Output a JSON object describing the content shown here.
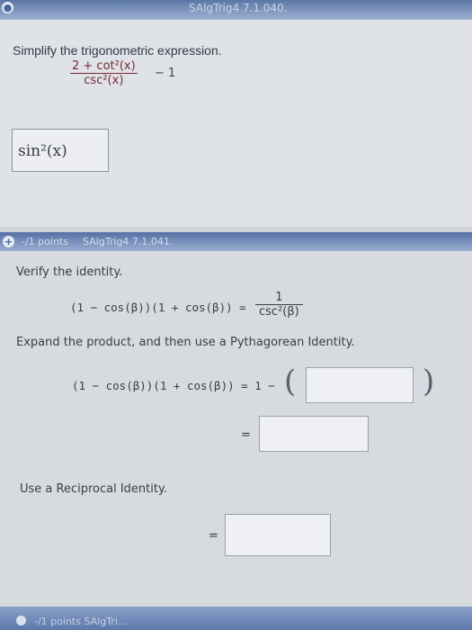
{
  "top_strip": {
    "faint_text": "SAlgTrig4 7.1.040."
  },
  "question1": {
    "prompt": "Simplify the trigonometric expression.",
    "numerator": "2 + cot²(x)",
    "denominator": "csc²(x)",
    "minus_term": "− 1",
    "answer": "sin²(x)"
  },
  "question2": {
    "points": "-/1 points",
    "code": "SAlgTrig4 7.1.041.",
    "prompt": "Verify the identity.",
    "identity_lhs": "(1 − cos(β))(1 + cos(β)) =",
    "identity_num": "1",
    "identity_den": "csc²(β)",
    "step1_instruction": "Expand the product, and then use a Pythagorean Identity.",
    "step1_lhs": "(1 − cos(β))(1 + cos(β)) = 1 −",
    "equals": "=",
    "step2_instruction": "Use a Reciprocal Identity.",
    "input1_value": "",
    "input2_value": "",
    "input3_value": ""
  },
  "bottom_strip": {
    "text": "-/1 points  SAlgTri..."
  }
}
